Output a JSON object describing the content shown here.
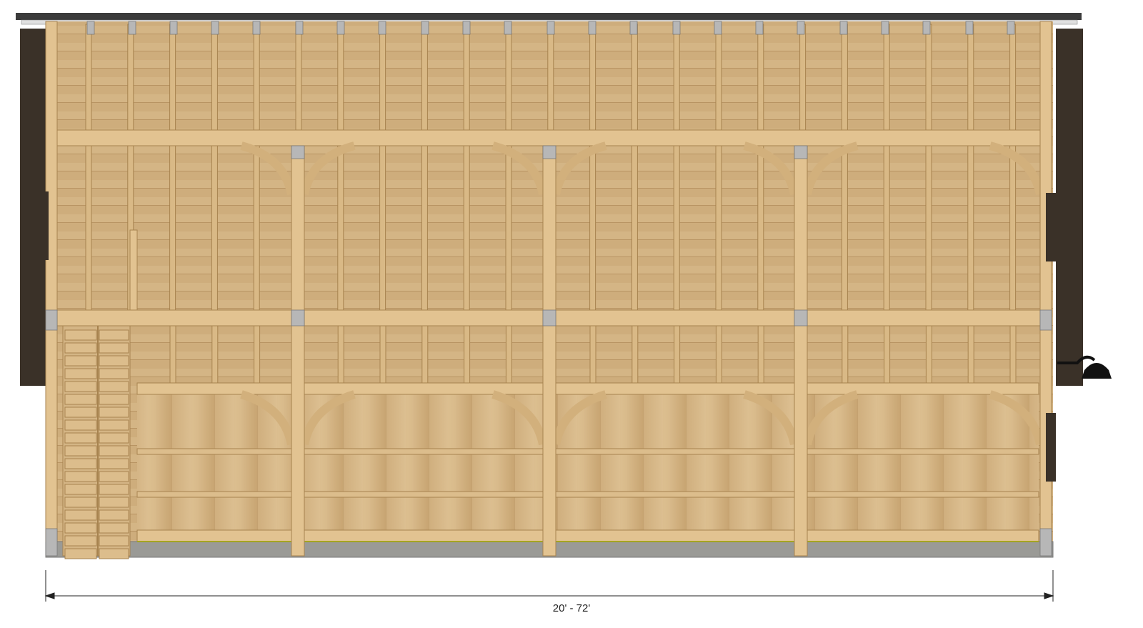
{
  "drawing": {
    "dimension_label": "20' - 72'"
  },
  "colors": {
    "wood_light": "#d7b88a",
    "wood_mid": "#c9a674",
    "wood_dark": "#b8915e",
    "timber": "#e2c391",
    "timber_edge": "#a7834f",
    "siding_dark": "#3a3128",
    "roof": "#3b3b3b",
    "steel_plate": "#b7b7b7",
    "concrete": "#9a9a96"
  },
  "icons": [
    "barn-light-icon",
    "stair-ladder-icon"
  ]
}
